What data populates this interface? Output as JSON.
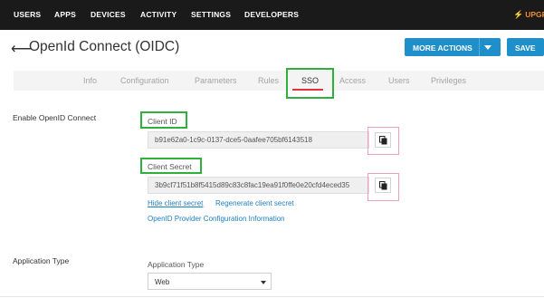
{
  "nav": {
    "items": [
      "USERS",
      "APPS",
      "DEVICES",
      "ACTIVITY",
      "SETTINGS",
      "DEVELOPERS"
    ],
    "upgrade_label": "UPGR"
  },
  "header": {
    "title": "OpenId Connect (OIDC)",
    "more_actions_label": "MORE ACTIONS",
    "save_label": "SAVE"
  },
  "tabs": {
    "items": [
      "Info",
      "Configuration",
      "Parameters",
      "Rules",
      "SSO",
      "Access",
      "Users",
      "Privileges"
    ],
    "active": "SSO"
  },
  "oidc": {
    "section_label": "Enable OpenID Connect",
    "client_id_label": "Client ID",
    "client_id_value": "b91e62a0-1c9c-0137-dce5-0aafee705bf6143518",
    "client_secret_label": "Client Secret",
    "client_secret_value": "3b9cf71f51b8f5415d89c83c8fac19ea91f0ffe0e20cfd4eced35",
    "hide_secret_link": "Hide client secret",
    "regenerate_link": "Regenerate client secret",
    "config_link": "OpenID Provider Configuration Information"
  },
  "application": {
    "section_label": "Application Type",
    "field_label": "Application Type",
    "selected_value": "Web"
  },
  "colors": {
    "nav_bg": "#1a1a1a",
    "primary_button": "#1e8fc8",
    "link": "#1e7fbf",
    "active_tab_underline": "#e0333a",
    "highlight_green": "#2db13a",
    "highlight_pink": "#ee9fc0",
    "upgrade": "#f08c2a"
  }
}
